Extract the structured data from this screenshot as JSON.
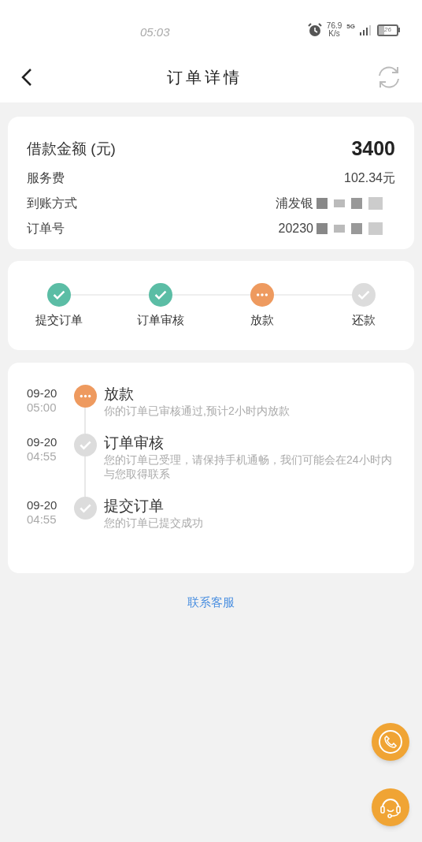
{
  "status_bar": {
    "time": "05:03",
    "net_speed": "76.9",
    "net_unit": "K/s",
    "network": "5G",
    "battery": "26"
  },
  "header": {
    "title": "订单详情"
  },
  "summary": {
    "amount_label": "借款金额 (元)",
    "amount": "3400",
    "rows": [
      {
        "label": "服务费",
        "value": "102.34元",
        "redacted": false
      },
      {
        "label": "到账方式",
        "value": "浦发银",
        "redacted": true
      },
      {
        "label": "订单号",
        "value": "20230",
        "redacted": true
      }
    ]
  },
  "steps": [
    {
      "label": "提交订单",
      "kind": "done"
    },
    {
      "label": "订单审核",
      "kind": "done"
    },
    {
      "label": "放款",
      "kind": "active"
    },
    {
      "label": "还款",
      "kind": "pending"
    }
  ],
  "timeline": [
    {
      "date": "09-20",
      "time": "05:00",
      "title": "放款",
      "text": "你的订单已审核通过,预计2小时内放款",
      "kind": "active"
    },
    {
      "date": "09-20",
      "time": "04:55",
      "title": "订单审核",
      "text": "您的订单已受理，请保持手机通畅，我们可能会在24小时内与您取得联系",
      "kind": "done"
    },
    {
      "date": "09-20",
      "time": "04:55",
      "title": "提交订单",
      "text": "您的订单已提交成功",
      "kind": "done"
    }
  ],
  "contact_link": "联系客服"
}
